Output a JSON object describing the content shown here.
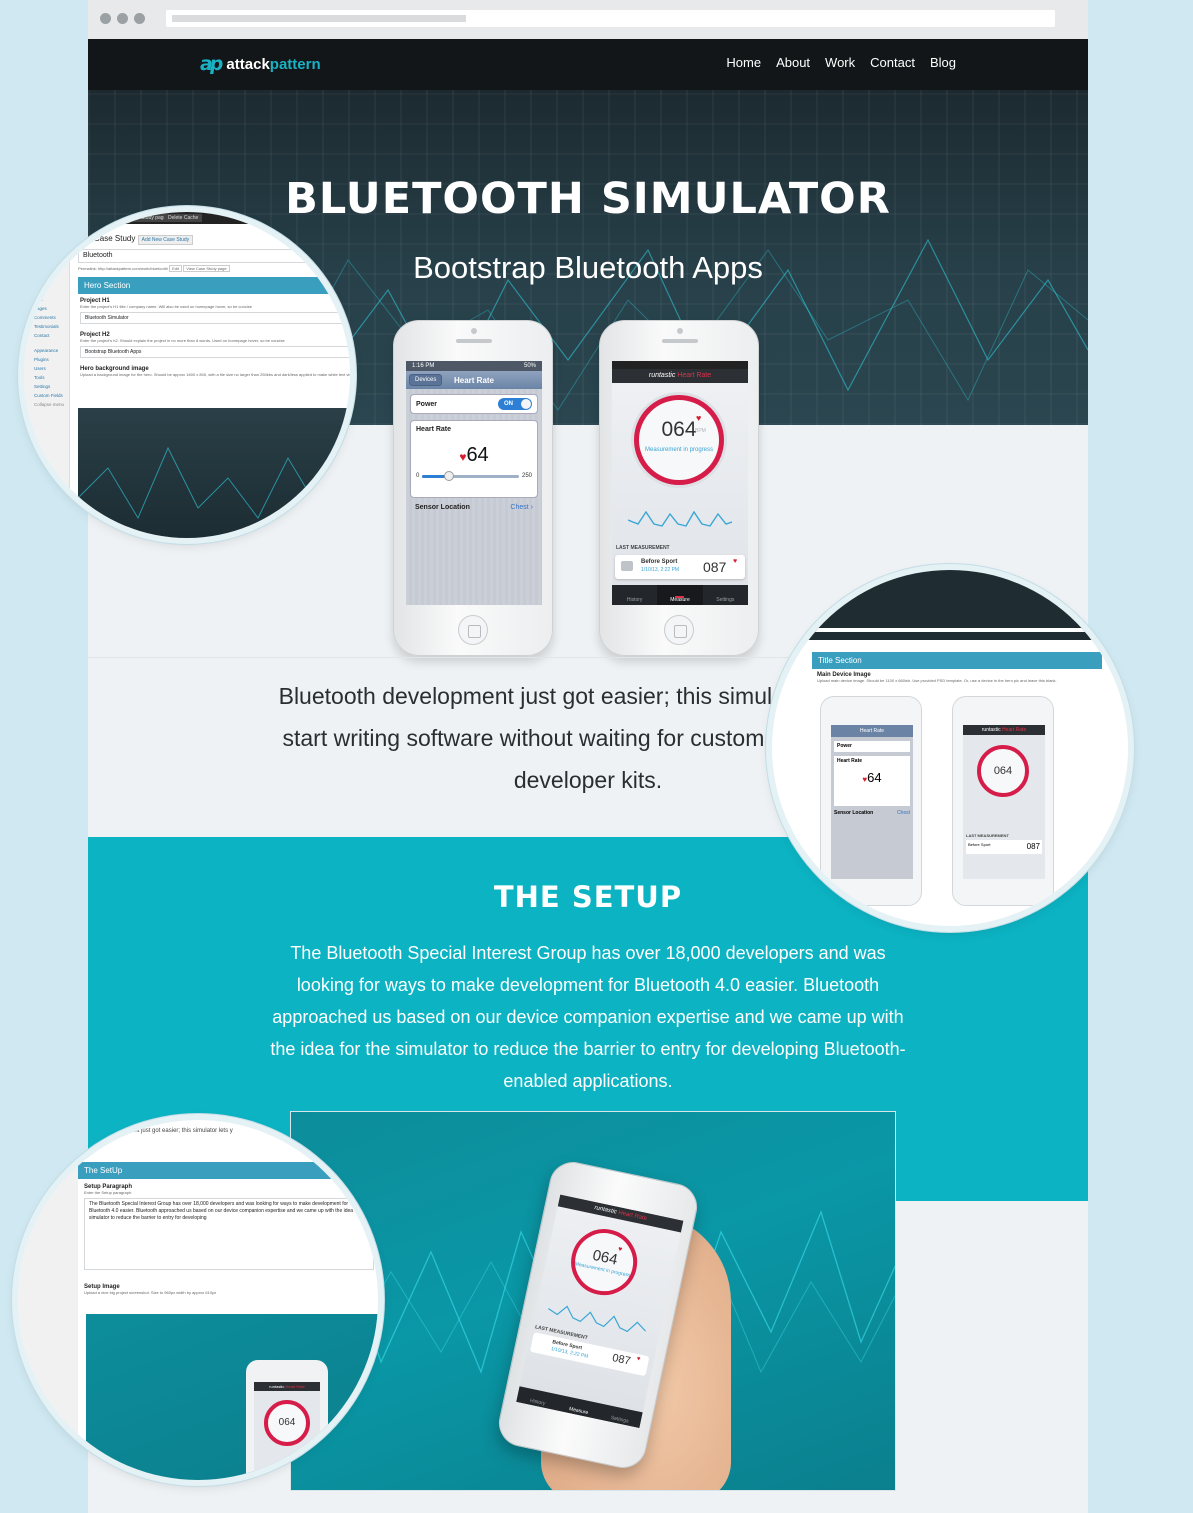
{
  "nav": {
    "logo_mark": "ap",
    "logo_prefix": "attack",
    "logo_suffix": "pattern",
    "items": [
      "Home",
      "About",
      "Work",
      "Contact",
      "Blog"
    ]
  },
  "hero": {
    "title": "Bluetooth Simulator",
    "subtitle": "Bootstrap Bluetooth Apps"
  },
  "phone1": {
    "time": "1:16 PM",
    "battery": "50%",
    "back_label": "Devices",
    "title": "Heart Rate",
    "power_label": "Power",
    "power_state": "ON",
    "hr_label": "Heart Rate",
    "hr_value": "64",
    "slider_min": "0",
    "slider_max": "250",
    "location_label": "Sensor Location",
    "location_value": "Chest"
  },
  "phone2": {
    "brand": "runtastic",
    "title": "Heart Rate",
    "reading": "064",
    "unit": "BPM",
    "status": "Measurement in progress",
    "last_label": "LAST MEASUREMENT",
    "last_title": "Before Sport",
    "last_date": "1/10/13, 2:22 PM",
    "last_value": "087",
    "tabs": [
      "History",
      "Measure",
      "Settings"
    ]
  },
  "intro": {
    "text": "Bluetooth development just got easier; this simulator lets you start writing software without waiting for custom hardware or developer kits."
  },
  "setup": {
    "title": "The Setup",
    "paragraph": "The Bluetooth Special Interest Group has over 18,000 developers and was looking for ways to make development for Bluetooth 4.0 easier. Bluetooth approached us based on our device companion expertise and we came up with the idea for the simulator to reduce the barrier to entry for developing Bluetooth-enabled applications."
  },
  "big_phone": {
    "brand": "runtastic",
    "title": "Heart Rate",
    "reading": "064",
    "status": "Measurement in progress",
    "last_label": "LAST MEASUREMENT",
    "last_title": "Before Sport",
    "last_date": "1/10/13, 2:22 PM",
    "last_value": "087",
    "tabs": [
      "History",
      "Measure",
      "Settings"
    ]
  },
  "circle1": {
    "buttons": [
      "Case Study page",
      "Delete Cache"
    ],
    "heading": "Edit Case Study",
    "add_new": "Add New Case Study",
    "title_value": "Bluetooth",
    "permalink": "Permalink: http://attackpattern.com/work/bluetooth/",
    "edit": "Edit",
    "view": "View Case Study page",
    "sidebar": [
      "Study",
      "edia",
      "Pages",
      "Comments",
      "Testimonials",
      "Contact",
      "Appearance",
      "Plugins",
      "Users",
      "Tools",
      "Settings",
      "Custom Fields",
      "Collapse menu"
    ],
    "section": "Hero Section",
    "h1_label": "Project H1",
    "h1_help": "Enter the project's H1 title / company name. Will also be used on homepage hover, so be concise",
    "h1_value": "Bluetooth Simulator",
    "h2_label": "Project H2",
    "h2_help": "Enter the project's h2. Should explain the project in no more than 8 words. Used on homepage hover, so be concise",
    "h2_value": "Bootstrap Bluetooth Apps",
    "bg_label": "Hero background image",
    "bg_help": "Upload a background image for the hero. Should be approx 1600 x 800, with a file size no larger than 250kbs and dark/less applied to make white text visible. If you use a device image..."
  },
  "circle2": {
    "section": "Title Section",
    "label": "Main Device Image",
    "help": "Upload main device image. Should be 1100 x 660ish. Use provided PSD template. Or, use a device in the hero pic and leave this blank."
  },
  "circle3": {
    "top_text": "Bluetooth development just got easier; this simulator lets y",
    "section": "The SetUp",
    "para_label": "Setup Paragraph",
    "para_help": "Enter the Setup paragraph.",
    "para_value": "The Bluetooth Special Interest Group has over 18,000 developers and was looking for ways to make development for Bluetooth 4.0 easier. Bluetooth approached us based on our device companion expertise and we came up with the idea for the simulator to reduce the barrier to entry for developing",
    "img_label": "Setup Image",
    "img_help": "Upload a nice big project screenshot. Size to 960px width by approx 610px"
  }
}
